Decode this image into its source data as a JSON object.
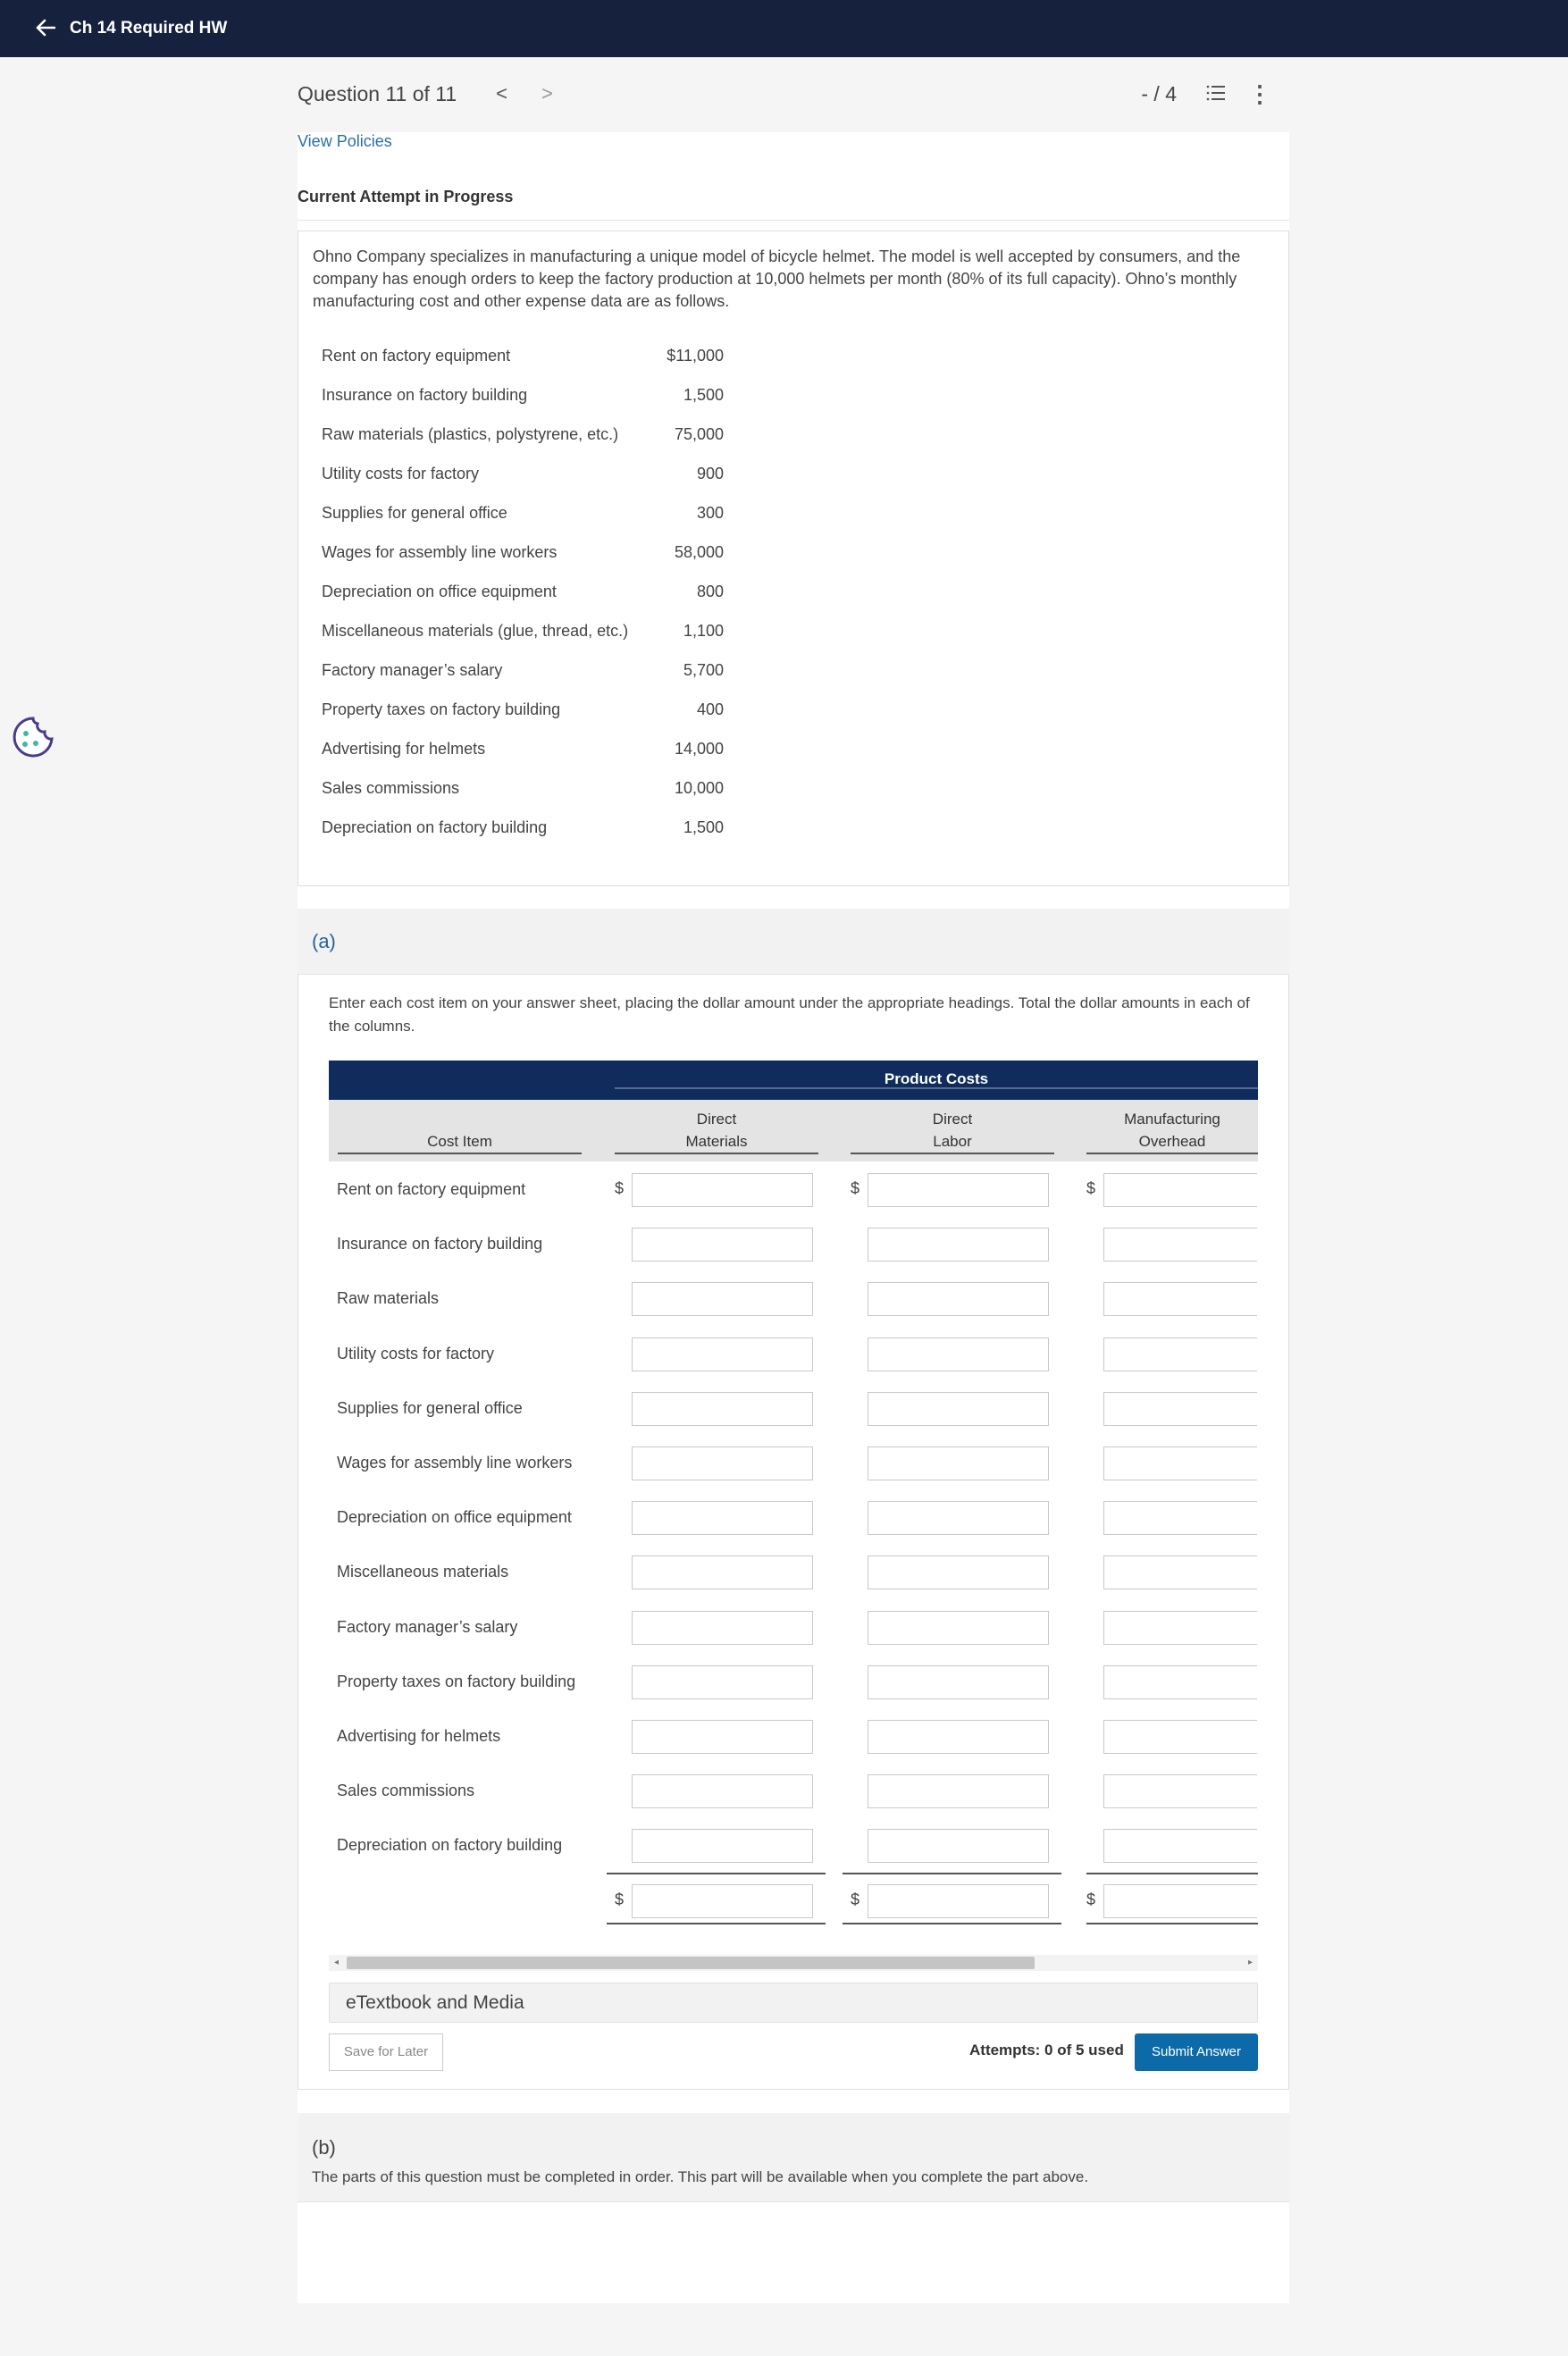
{
  "topbar": {
    "back_icon": "arrow-left-icon",
    "title": "Ch 14 Required HW"
  },
  "question_nav": {
    "question_label": "Question 11 of 11",
    "prev": "<",
    "next": ">",
    "score": "- / 4",
    "list_icon": "list-icon",
    "more": "⋮"
  },
  "view_policies": "View Policies",
  "attempt_status": "Current Attempt in Progress",
  "problem": {
    "text": "Ohno Company specializes in manufacturing a unique model of bicycle helmet. The model is well accepted by consumers, and the company has enough orders to keep the factory production at 10,000 helmets per month (80% of its full capacity). Ohno’s monthly manufacturing cost and other expense data are as follows.",
    "items": [
      {
        "label": "Rent on factory equipment",
        "value": "$11,000"
      },
      {
        "label": "Insurance on factory building",
        "value": "1,500"
      },
      {
        "label": "Raw materials (plastics, polystyrene, etc.)",
        "value": "75,000"
      },
      {
        "label": "Utility costs for factory",
        "value": "900"
      },
      {
        "label": "Supplies for general office",
        "value": "300"
      },
      {
        "label": "Wages for assembly line workers",
        "value": "58,000"
      },
      {
        "label": "Depreciation on office equipment",
        "value": "800"
      },
      {
        "label": "Miscellaneous materials (glue, thread, etc.)",
        "value": "1,100"
      },
      {
        "label": "Factory manager’s salary",
        "value": "5,700"
      },
      {
        "label": "Property taxes on factory building",
        "value": "400"
      },
      {
        "label": "Advertising for helmets",
        "value": "14,000"
      },
      {
        "label": "Sales commissions",
        "value": "10,000"
      },
      {
        "label": "Depreciation on factory building",
        "value": "1,500"
      }
    ]
  },
  "part_a": {
    "label": "(a)",
    "instructions": "Enter each cost item on your answer sheet, placing the dollar amount under the appropriate headings. Total the dollar amounts in each of the columns.",
    "table": {
      "group_header": "Product Costs",
      "col_cost_item": "Cost Item",
      "col_dm": [
        "Direct",
        "Materials"
      ],
      "col_dl": [
        "Direct",
        "Labor"
      ],
      "col_moh": [
        "Manufacturing",
        "Overhead"
      ],
      "dollar_sign": "$",
      "rows": [
        "Rent on factory equipment",
        "Insurance on factory building",
        "Raw materials",
        "Utility costs for factory",
        "Supplies for general office",
        "Wages for assembly line workers",
        "Depreciation on office equipment",
        "Miscellaneous materials",
        "Factory manager’s salary",
        "Property taxes on factory building",
        "Advertising for helmets",
        "Sales commissions",
        "Depreciation on factory building"
      ]
    },
    "etextbook": "eTextbook and Media",
    "save_label": "Save for Later",
    "attempts_label": "Attempts: 0 of 5 used",
    "submit_label": "Submit Answer"
  },
  "part_b": {
    "label": "(b)",
    "note": "The parts of this question must be completed in order. This part will be available when you complete the part above."
  }
}
